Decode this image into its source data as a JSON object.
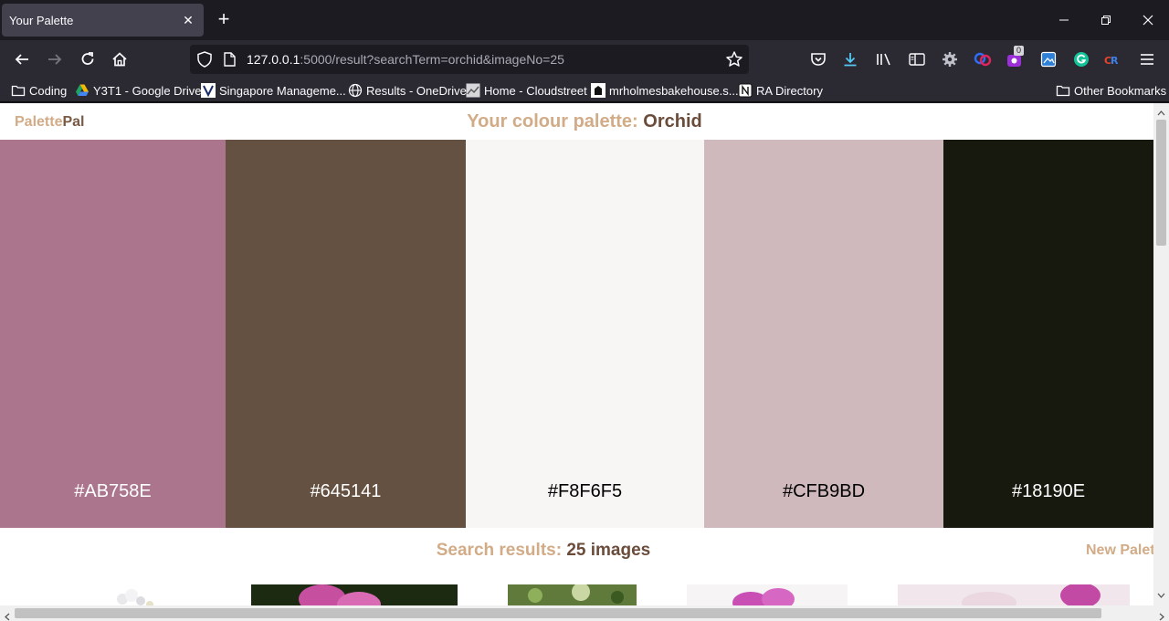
{
  "browser": {
    "tab_title": "Your Palette",
    "tab_close": "✕",
    "new_tab": "+",
    "url_host": "127.0.0.1",
    "url_rest": ":5000/result?searchTerm=orchid&imageNo=25",
    "extension_badge": "0"
  },
  "bookmarks": [
    {
      "label": "Coding"
    },
    {
      "label": "Y3T1 - Google Drive"
    },
    {
      "label": "Singapore Manageme..."
    },
    {
      "label": "Results - OneDrive"
    },
    {
      "label": "Home - Cloudstreet"
    },
    {
      "label": "mrholmesbakehouse.s..."
    },
    {
      "label": "RA Directory"
    }
  ],
  "other_bookmarks": "Other Bookmarks",
  "page": {
    "brand_part1": "Palette",
    "brand_part2": "Pal",
    "title_prefix": "Your colour palette:",
    "title_term": "Orchid",
    "results_prefix": "Search results:",
    "results_count": "25 images",
    "new_palette": "New Palet"
  },
  "swatches": [
    {
      "hex": "#AB758E",
      "text_color": "#ffffff"
    },
    {
      "hex": "#645141",
      "text_color": "#ffffff"
    },
    {
      "hex": "#F8F6F5",
      "text_color": "#000000"
    },
    {
      "hex": "#CFB9BD",
      "text_color": "#000000"
    },
    {
      "hex": "#18190E",
      "text_color": "#ffffff"
    }
  ],
  "colors": {
    "accent_tan": "#d2ab87",
    "accent_brown": "#6b4c3b"
  }
}
